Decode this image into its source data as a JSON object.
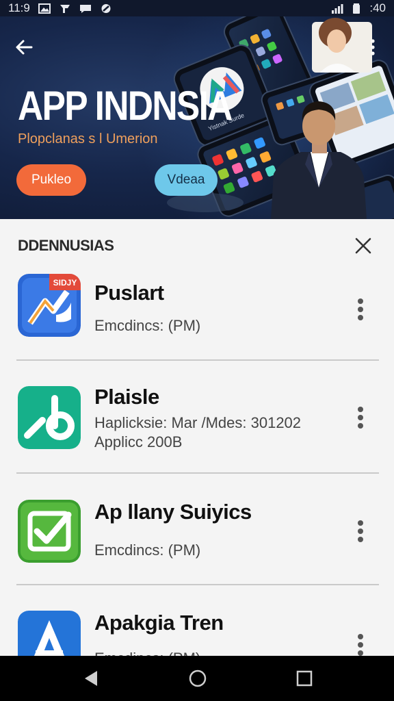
{
  "status_bar": {
    "time": "11:9",
    "right_text": ":40"
  },
  "hero": {
    "title": "APP INDNSIA",
    "subtitle": "Plopclanas s l Umerion",
    "primary_button": "Pukleo",
    "secondary_button": "Vdeaa",
    "tablet_caption": "Yistnak Surde",
    "accent_color": "#f26a3a",
    "secondary_color": "#6ec8ea"
  },
  "sheet": {
    "header": "DDENNUSIAS",
    "apps": [
      {
        "name": "Puslart",
        "meta": [
          "Emcdincs: (PM)"
        ],
        "icon": "blue-chart-app-icon",
        "badge": "SIDJY"
      },
      {
        "name": "Plaisle",
        "meta": [
          "Haplicksie: Mar /Mdes: 301202",
          "Applicc 200B"
        ],
        "icon": "teal-b-app-icon"
      },
      {
        "name": "Ap llany Suiyics",
        "meta": [
          "Emcdincs: (PM)"
        ],
        "icon": "green-check-app-icon"
      },
      {
        "name": "Apakgia Tren",
        "meta": [
          "Emcdincs: (PM)"
        ],
        "icon": "blue-a-app-icon"
      }
    ]
  }
}
